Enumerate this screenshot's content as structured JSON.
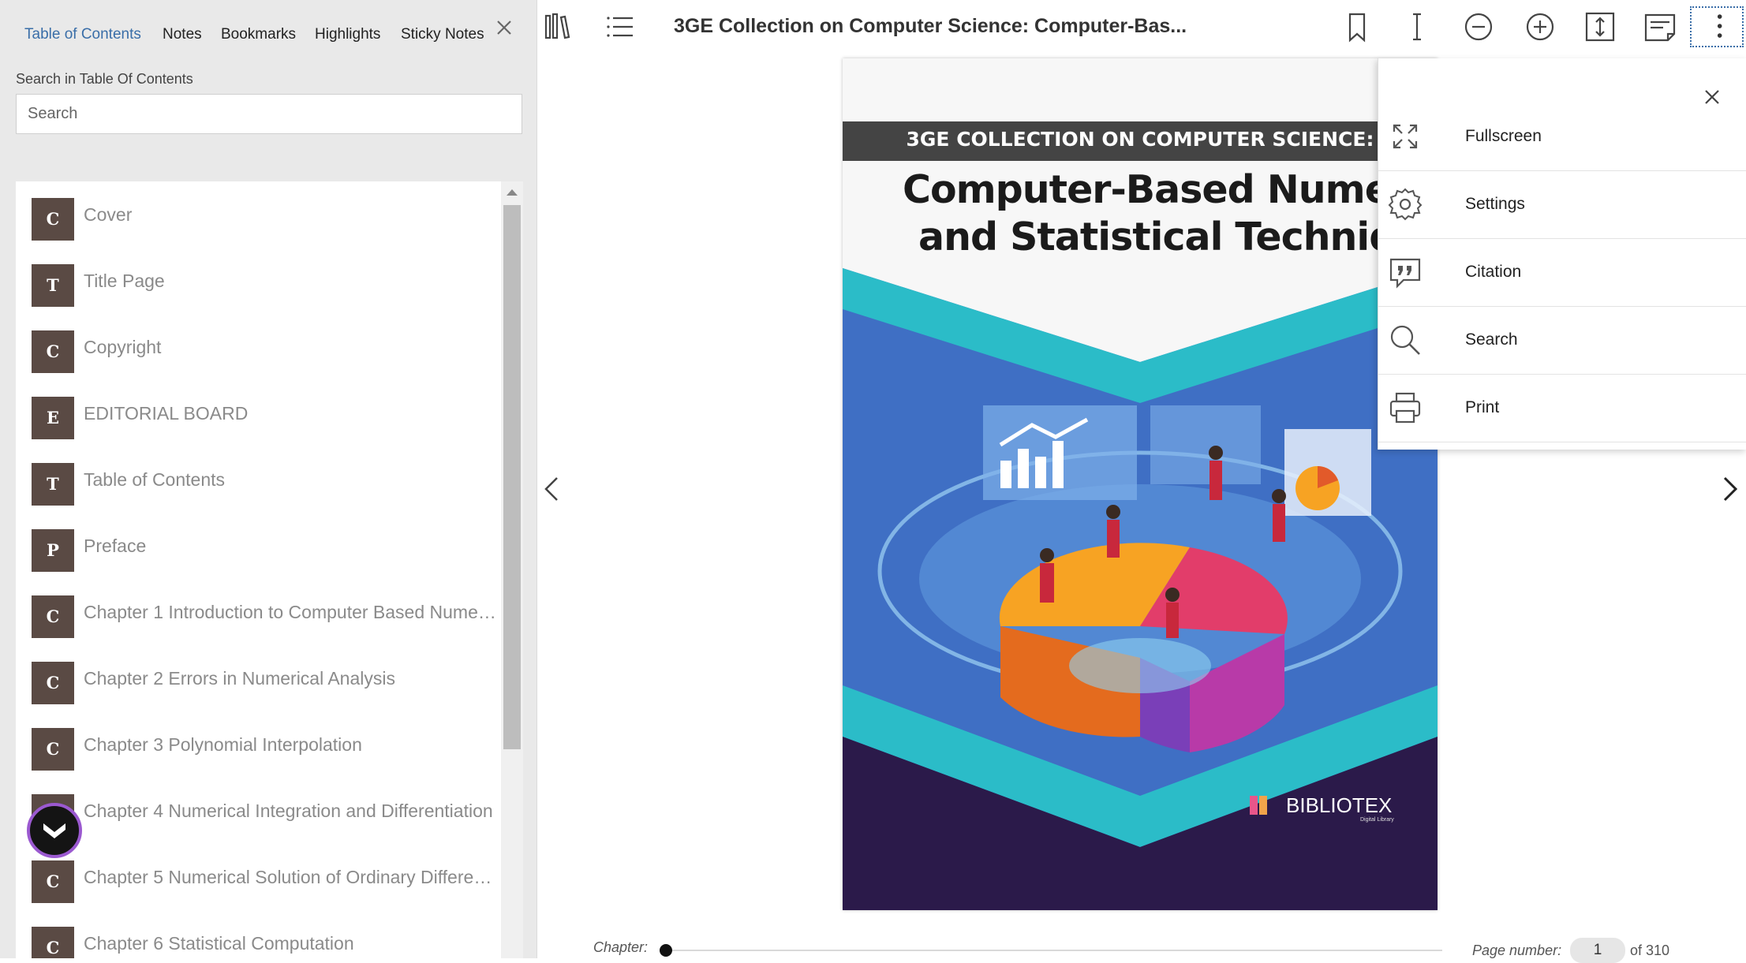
{
  "panel": {
    "tabs": [
      {
        "label": "Table of Contents",
        "active": true
      },
      {
        "label": "Notes"
      },
      {
        "label": "Bookmarks"
      },
      {
        "label": "Highlights"
      },
      {
        "label": "Sticky Notes"
      }
    ],
    "search_label": "Search in Table Of Contents",
    "search_placeholder": "Search",
    "toc": [
      {
        "badge": "C",
        "label": "Cover"
      },
      {
        "badge": "T",
        "label": "Title Page"
      },
      {
        "badge": "C",
        "label": "Copyright"
      },
      {
        "badge": "E",
        "label": "EDITORIAL BOARD"
      },
      {
        "badge": "T",
        "label": "Table of Contents"
      },
      {
        "badge": "P",
        "label": "Preface"
      },
      {
        "badge": "C",
        "label": "Chapter 1 Introduction to Computer Based Numer..."
      },
      {
        "badge": "C",
        "label": "Chapter 2 Errors in Numerical Analysis"
      },
      {
        "badge": "C",
        "label": "Chapter 3 Polynomial Interpolation"
      },
      {
        "badge": "C",
        "label": "Chapter 4 Numerical Integration and Differentiation"
      },
      {
        "badge": "C",
        "label": "Chapter 5 Numerical Solution of Ordinary Differen..."
      },
      {
        "badge": "C",
        "label": "Chapter 6 Statistical Computation"
      }
    ]
  },
  "toolbar": {
    "title": "3GE Collection on Computer Science: Computer-Bas...",
    "icons": [
      "library-icon",
      "list-icon",
      "bookmark-icon",
      "text-cursor-icon",
      "zoom-out-icon",
      "zoom-in-icon",
      "fit-height-icon",
      "notes-icon",
      "more-vertical-icon"
    ]
  },
  "cover": {
    "series": "3GE COLLECTION ON COMPUTER SCIENCE:",
    "title_line1": "Computer-Based Numerical",
    "title_line2": "and Statistical Techniques",
    "publisher": "BIBLIOTEX",
    "publisher_sub": "Digital Library"
  },
  "menu": {
    "items": [
      {
        "label": "Fullscreen",
        "icon": "fullscreen-icon"
      },
      {
        "label": "Settings",
        "icon": "gear-icon"
      },
      {
        "label": "Citation",
        "icon": "citation-icon"
      },
      {
        "label": "Search",
        "icon": "search-icon"
      },
      {
        "label": "Print",
        "icon": "printer-icon"
      }
    ]
  },
  "footer": {
    "chapter_label": "Chapter:",
    "page_label": "Page number:",
    "page_value": "1",
    "page_total": "of 310"
  },
  "colors": {
    "accent": "#3a6ea8",
    "badge": "#5a4a44",
    "cover_dark": "#2b1a4a",
    "cover_blue": "#3f6fc4",
    "cover_teal": "#2bbcc8"
  }
}
